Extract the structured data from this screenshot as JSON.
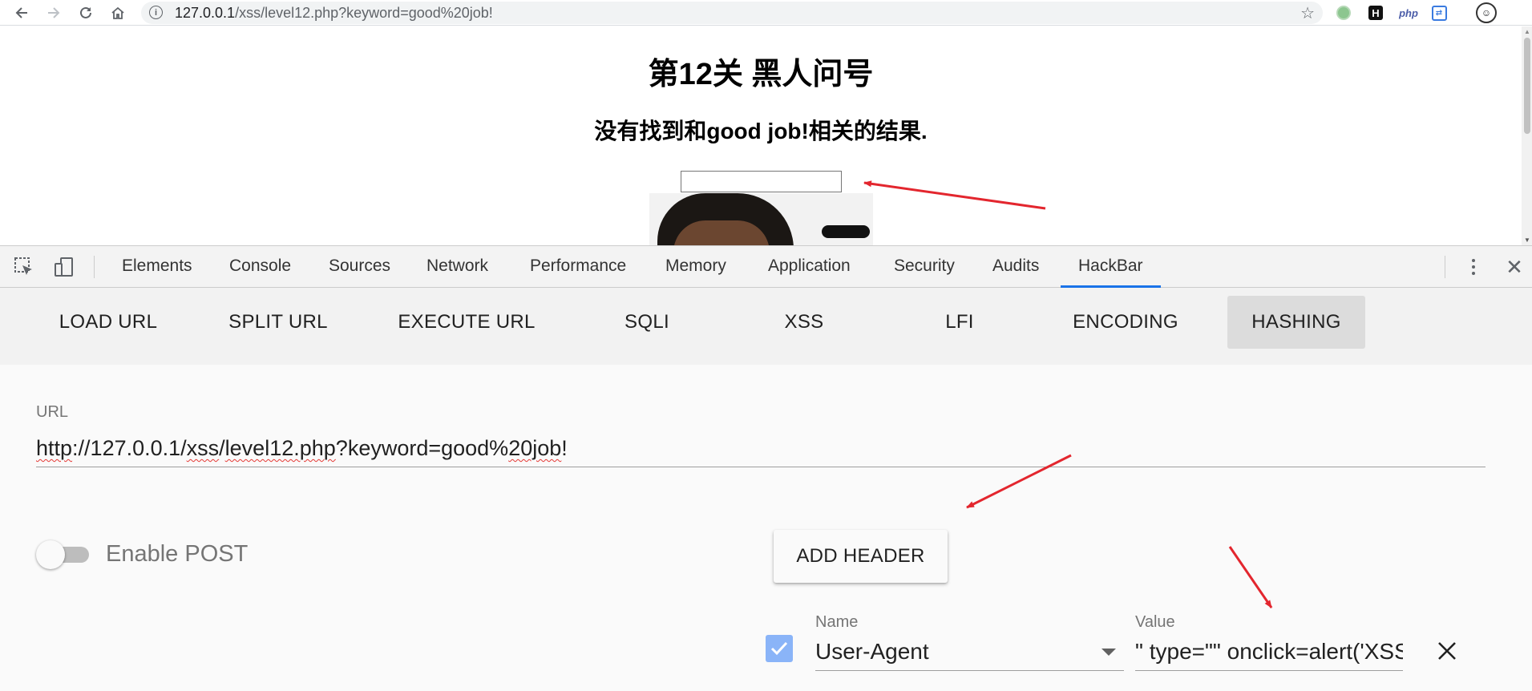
{
  "browser": {
    "url_host": "127.0.0.1",
    "url_path": "/xss/level12.php?keyword=good%20job!",
    "icons": {
      "back": "back-arrow-icon",
      "forward": "forward-arrow-icon",
      "reload": "reload-icon",
      "home": "home-icon",
      "info": "info-icon",
      "bookmark": "star-icon"
    },
    "extensions": {
      "hackbar_letter": "H",
      "php_label": "php"
    }
  },
  "page": {
    "title": "第12关 黑人问号",
    "result_text": "没有找到和good job!相关的结果."
  },
  "devtools": {
    "tabs": [
      "Elements",
      "Console",
      "Sources",
      "Network",
      "Performance",
      "Memory",
      "Application",
      "Security",
      "Audits",
      "HackBar"
    ],
    "active_tab": "HackBar"
  },
  "hackbar": {
    "menu": [
      "LOAD URL",
      "SPLIT URL",
      "EXECUTE URL",
      "SQLI",
      "XSS",
      "LFI",
      "ENCODING",
      "HASHING"
    ],
    "active_menu": "HASHING",
    "url_label": "URL",
    "url_scheme": "http",
    "url_part1": "://127.0.0.1/",
    "url_xss": "xss",
    "url_slash": "/",
    "url_level": "level12.php",
    "url_query": "?keyword=good%",
    "url_job": "20job",
    "url_end": "!",
    "enable_post_label": "Enable POST",
    "enable_post": false,
    "add_header_label": "ADD HEADER",
    "header": {
      "enabled": true,
      "name_label": "Name",
      "name_value": "User-Agent",
      "value_label": "Value",
      "value_value": "\" type=\"\" onclick=alert('XSS')"
    }
  },
  "colors": {
    "accent": "#1a73e8",
    "annotation_arrow": "#e3262e",
    "checkbox": "#8ab4f8"
  }
}
